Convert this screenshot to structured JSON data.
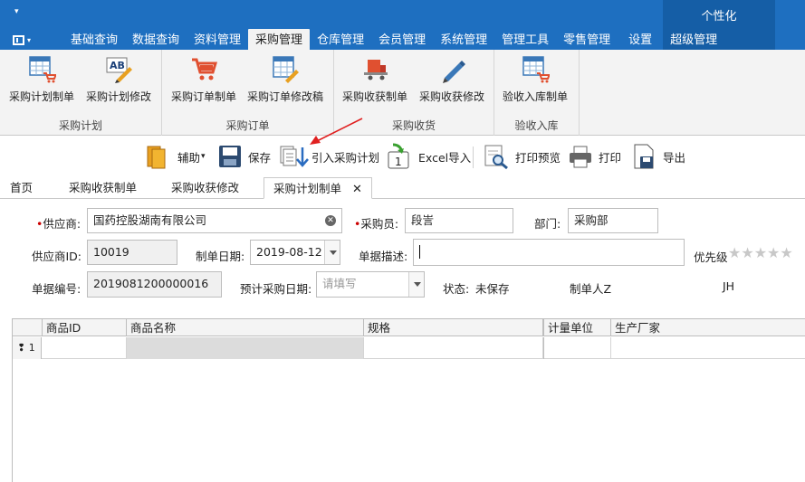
{
  "window": {
    "quick_access_arrow": "▾",
    "personalize_label": "个性化"
  },
  "ribbon_tabs": [
    {
      "label": "基础查询"
    },
    {
      "label": "数据查询"
    },
    {
      "label": "资料管理"
    },
    {
      "label": "采购管理"
    },
    {
      "label": "仓库管理"
    },
    {
      "label": "会员管理"
    },
    {
      "label": "系统管理"
    },
    {
      "label": "管理工具"
    },
    {
      "label": "零售管理"
    },
    {
      "label": "设置"
    },
    {
      "label": "超级管理"
    }
  ],
  "ribbon_groups": {
    "plan": {
      "label": "采购计划",
      "buttons": [
        "采购计划制单",
        "采购计划修改"
      ]
    },
    "order": {
      "label": "采购订单",
      "buttons": [
        "采购订单制单",
        "采购订单修改稿"
      ]
    },
    "receive": {
      "label": "采购收货",
      "buttons": [
        "采购收获制单",
        "采购收获修改"
      ]
    },
    "inbound": {
      "label": "验收入库",
      "buttons": [
        "验收入库制单"
      ]
    }
  },
  "toolbar": {
    "assist": "辅助",
    "assist_arrow": "▾",
    "save": "保存",
    "import_plan": "引入采购计划",
    "excel_import": "Excel导入",
    "print_preview": "打印预览",
    "print": "打印",
    "export": "导出"
  },
  "doc_tabs": [
    {
      "label": "首页"
    },
    {
      "label": "采购收获制单"
    },
    {
      "label": "采购收获修改"
    },
    {
      "label": "采购计划制单"
    }
  ],
  "doc_tab_close": "✕",
  "form": {
    "supplier_label": "供应商:",
    "supplier_value": "国药控股湖南有限公司",
    "buyer_label": "采购员:",
    "buyer_value": "段訔",
    "dept_label": "部门:",
    "dept_value": "采购部",
    "supplier_id_label": "供应商ID:",
    "supplier_id_value": "10019",
    "date_label": "制单日期:",
    "date_value": "2019-08-12",
    "desc_label": "单据描述:",
    "desc_value": "",
    "priority_label": "优先级",
    "priority_stars": "★★★★★",
    "priority_rating": 0,
    "doc_no_label": "单据编号:",
    "doc_no_value": "2019081200000016",
    "expected_date_label": "预计采购日期:",
    "expected_date_placeholder": "请填写",
    "status_label": "状态:",
    "status_value": "未保存",
    "maker_label": "制单人Z",
    "maker_value": "JH",
    "required_mark": "•"
  },
  "grid": {
    "columns": [
      "商品ID",
      "商品名称",
      "规格",
      "计量单位",
      "生产厂家"
    ],
    "rows": [
      {
        "indicator": "❢ 1",
        "cells": [
          "",
          "",
          "",
          "",
          ""
        ]
      }
    ]
  },
  "colors": {
    "ribbon_blue": "#1e6fc0",
    "personal_blue": "#155ea6",
    "ribbon_bg": "#f3f3f3",
    "required_red": "#cc0000",
    "annotation_arrow": "#e02020"
  }
}
